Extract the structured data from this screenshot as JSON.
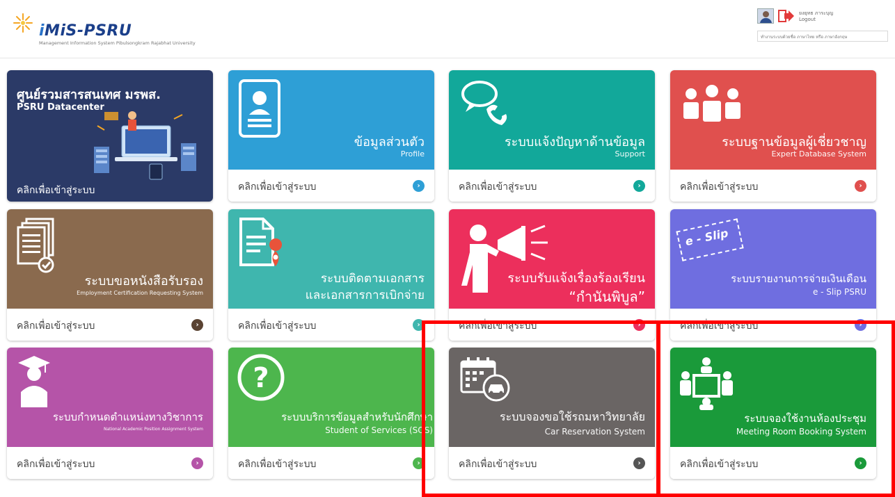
{
  "header": {
    "logo_text_i": "i",
    "logo_text_rest": "MiS-PSRU",
    "logo_sub": "Management Information System Pibulsongkram Rajabhat University",
    "user_name": "ยงยุทธ ภาระบุญ",
    "logout_label": "Logout",
    "lang_text": "ทำงานระบบด้วยชื่อ ภาษาไทย หรือ ภาษาอังกฤษ"
  },
  "tiles": [
    {
      "title": "ศูนย์รวมสารสนเทศ มรพส.",
      "subtitle": "PSRU Datacenter",
      "link": "คลิกเพื่อเข้าสู่ระบบ",
      "color": "#2b3a67"
    },
    {
      "title": "ข้อมูลส่วนตัว",
      "subtitle": "Profile",
      "link": "คลิกเพื่อเข้าสู่ระบบ",
      "color": "#2e9fd6",
      "arrow_color": "#2e9fd6"
    },
    {
      "title": "ระบบแจ้งปัญหาด้านข้อมูล",
      "subtitle": "Support",
      "link": "คลิกเพื่อเข้าสู่ระบบ",
      "color": "#12a89a",
      "arrow_color": "#12a89a"
    },
    {
      "title": "ระบบฐานข้อมูลผู้เชี่ยวชาญ",
      "subtitle": "Expert Database System",
      "link": "คลิกเพื่อเข้าสู่ระบบ",
      "color": "#e0504e",
      "arrow_color": "#e0504e"
    },
    {
      "title": "ระบบขอหนังสือรับรอง",
      "subtitle": "Employment Certification Requesting System",
      "link": "คลิกเพื่อเข้าสู่ระบบ",
      "color": "#8a6a4e",
      "arrow_color": "#5a4332"
    },
    {
      "title": "ระบบติดตามเอกสาร",
      "title2": "และเอกสารการเบิกจ่าย",
      "link": "คลิกเพื่อเข้าสู่ระบบ",
      "color": "#3fb6ae",
      "arrow_color": "#3fb6ae"
    },
    {
      "title": "ระบบรับแจ้งเรื่องร้องเรียน",
      "title2": "“กำนันพิบูล”",
      "link": "คลิกเพื่อเข้าสู่ระบบ",
      "color": "#ec2f5c",
      "arrow_color": "#ec2f5c"
    },
    {
      "title": "ระบบรายงานการจ่ายเงินเดือน",
      "subtitle": "e - Slip PSRU",
      "link": "คลิกเพื่อเข้าสู่ระบบ",
      "color": "#6f6ee0",
      "arrow_color": "#6f6ee0",
      "slip_label": "e - Slip"
    },
    {
      "title": "ระบบกำหนดตำแหน่งทางวิชาการ",
      "subtitle": "National Academic Position Assignment System",
      "link": "คลิกเพื่อเข้าสู่ระบบ",
      "color": "#b554a8",
      "arrow_color": "#b554a8"
    },
    {
      "title": "ระบบบริการข้อมูลสำหรับนักศึกษา",
      "subtitle": "Student of Services (SOS)",
      "link": "คลิกเพื่อเข้าสู่ระบบ",
      "color": "#4db64d",
      "arrow_color": "#4db64d"
    },
    {
      "title": "ระบบจองขอใช้รถมหาวิทยาลัย",
      "subtitle": "Car Reservation System",
      "link": "คลิกเพื่อเข้าสู่ระบบ",
      "color": "#6a6564",
      "arrow_color": "#555"
    },
    {
      "title": "ระบบจองใช้งานห้องประชุม",
      "subtitle": "Meeting Room Booking System",
      "link": "คลิกเพื่อเข้าสู่ระบบ",
      "color": "#1a9a3a",
      "arrow_color": "#1a9a3a"
    }
  ],
  "arrow_glyph": "›",
  "highlight_color": "#ff0000"
}
